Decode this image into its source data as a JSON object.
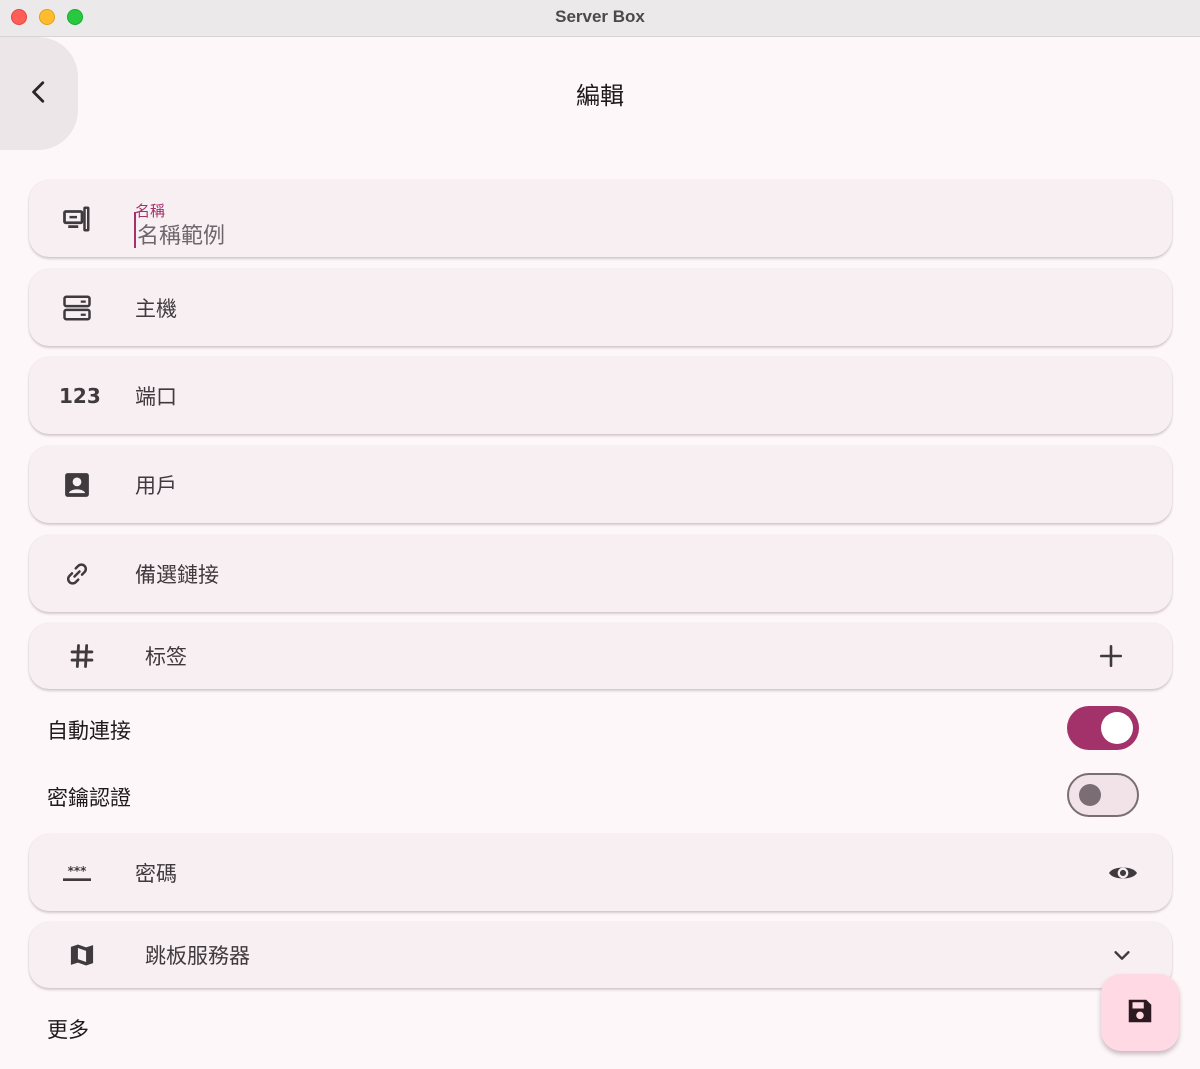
{
  "window": {
    "title": "Server Box"
  },
  "appbar": {
    "title": "編輯",
    "back_icon": "chevron-left-icon"
  },
  "fields": {
    "name": {
      "label": "名稱",
      "value": "名稱範例",
      "icon": "computer-icon"
    },
    "host": {
      "label": "主機",
      "icon": "server-storage-icon"
    },
    "port": {
      "label": "端口",
      "icon_text": "123"
    },
    "user": {
      "label": "用戶",
      "icon": "account-box-icon"
    },
    "alt_url": {
      "label": "備選鏈接",
      "icon": "link-icon"
    },
    "tags": {
      "label": "标签",
      "icon": "hashtag-icon",
      "trailing_icon": "plus-icon"
    },
    "password": {
      "label": "密碼",
      "icon": "password-icon",
      "trailing_icon": "eye-icon"
    },
    "jump_server": {
      "label": "跳板服務器",
      "icon": "map-icon",
      "trailing_icon": "chevron-down-icon"
    }
  },
  "toggles": {
    "auto_connect": {
      "label": "自動連接",
      "on": true
    },
    "key_auth": {
      "label": "密鑰認證",
      "on": false
    }
  },
  "more": {
    "label": "更多"
  },
  "fab": {
    "icon": "save-icon"
  },
  "colors": {
    "accent": "#a3326a",
    "card_bg": "#f8eff3",
    "page_bg": "#fdf7f9",
    "fab_bg": "#ffd9e3"
  }
}
